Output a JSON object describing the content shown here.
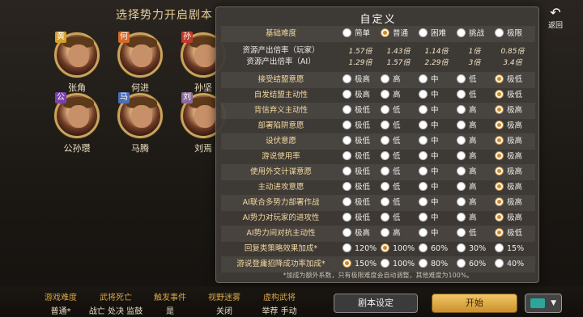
{
  "background": {
    "title": "选择势力开启剧本",
    "characters": [
      {
        "name": "张角",
        "badge": "黄",
        "badge_color": "#d4a02a"
      },
      {
        "name": "何进",
        "badge": "何",
        "badge_color": "#d46a2a"
      },
      {
        "name": "孙坚",
        "badge": "孙",
        "badge_color": "#c0392b"
      },
      {
        "name": "公孙瓒",
        "badge": "公",
        "badge_color": "#7b3fb0"
      },
      {
        "name": "马腾",
        "badge": "马",
        "badge_color": "#4a6fb5"
      },
      {
        "name": "刘焉",
        "badge": "刘",
        "badge_color": "#8a6a9a"
      }
    ]
  },
  "back_button": {
    "label": "返回"
  },
  "dialog": {
    "title": "自定义",
    "difficulty": {
      "label": "基础难度",
      "options": [
        "简单",
        "普通",
        "困难",
        "挑战",
        "极限"
      ],
      "selected": 1
    },
    "resource_player": {
      "label": "资源产出倍率（玩家）",
      "values": [
        "1.57倍",
        "1.43倍",
        "1.14倍",
        "1倍",
        "0.85倍"
      ]
    },
    "resource_ai": {
      "label": "资源产出倍率（AI）",
      "values": [
        "1.29倍",
        "1.57倍",
        "2.29倍",
        "3倍",
        "3.4倍"
      ]
    },
    "rows": [
      {
        "label": "接受结盟意愿",
        "options": [
          "极高",
          "高",
          "中",
          "低",
          "极低"
        ],
        "selected": 4
      },
      {
        "label": "自发结盟主动性",
        "options": [
          "极高",
          "高",
          "中",
          "低",
          "极低"
        ],
        "selected": 4
      },
      {
        "label": "背信弃义主动性",
        "options": [
          "极低",
          "低",
          "中",
          "高",
          "极高"
        ],
        "selected": 4
      },
      {
        "label": "部署陷阱意愿",
        "options": [
          "极低",
          "低",
          "中",
          "高",
          "极高"
        ],
        "selected": 4
      },
      {
        "label": "设伏意愿",
        "options": [
          "极低",
          "低",
          "中",
          "高",
          "极高"
        ],
        "selected": 4
      },
      {
        "label": "游说使用率",
        "options": [
          "极低",
          "低",
          "中",
          "高",
          "极高"
        ],
        "selected": 4
      },
      {
        "label": "使用外交计谋意愿",
        "options": [
          "极低",
          "低",
          "中",
          "高",
          "极高"
        ],
        "selected": 4
      },
      {
        "label": "主动进攻意愿",
        "options": [
          "极低",
          "低",
          "中",
          "高",
          "极高"
        ],
        "selected": 4
      },
      {
        "label": "AI联合多势力部署作战",
        "options": [
          "极低",
          "低",
          "中",
          "高",
          "极高"
        ],
        "selected": 4
      },
      {
        "label": "AI势力对玩家的进攻性",
        "options": [
          "极低",
          "低",
          "中",
          "高",
          "极高"
        ],
        "selected": 4
      },
      {
        "label": "AI势力间对抗主动性",
        "options": [
          "极高",
          "高",
          "中",
          "低",
          "极低"
        ],
        "selected": 4
      },
      {
        "label": "回复类策略效果加成*",
        "options": [
          "120%",
          "100%",
          "60%",
          "30%",
          "15%"
        ],
        "selected": 1
      },
      {
        "label": "游说登庸招降成功率加成*",
        "options": [
          "150%",
          "100%",
          "80%",
          "60%",
          "40%"
        ],
        "selected": 0
      }
    ],
    "footnote": "*加成为额外系数，只有极限难度会自动调整，其他难度为100%。"
  },
  "bottom_info": [
    {
      "label": "游戏难度",
      "value": "普通*"
    },
    {
      "label": "武将死亡",
      "value": "战亡 处决 监鼓"
    },
    {
      "label": "触发事件",
      "value": "是"
    },
    {
      "label": "视野迷雾",
      "value": "关闭"
    },
    {
      "label": "虚构武将",
      "value": "举荐 手动"
    }
  ],
  "buttons": {
    "script_settings": "剧本设定",
    "start": "开始",
    "color_dropdown": "▼"
  },
  "colors": {
    "accent_gold": "#d4a545",
    "start_button": "#e6b450",
    "selected_swatch": "#2ba79a"
  }
}
